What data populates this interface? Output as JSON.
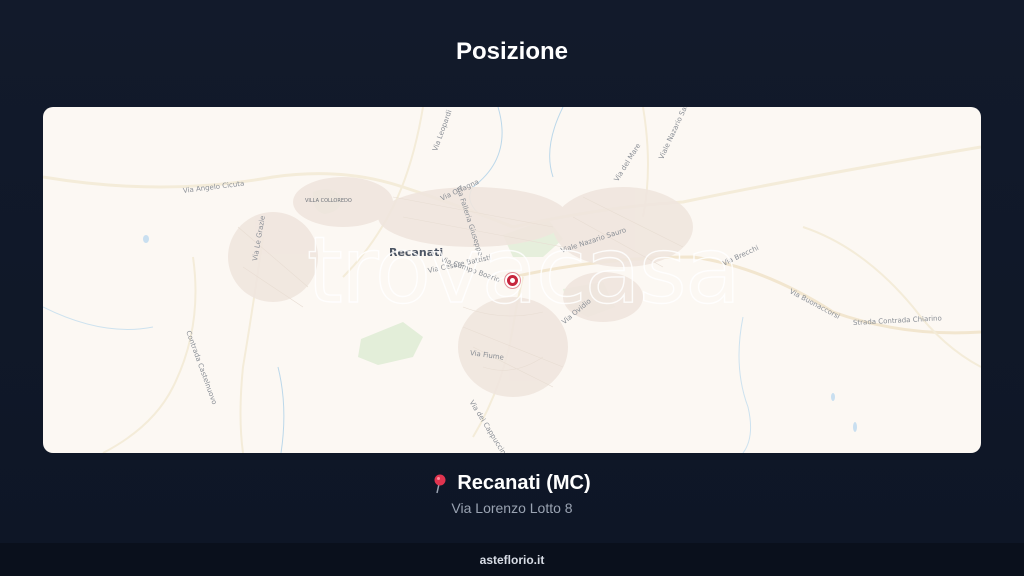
{
  "page": {
    "title": "Posizione"
  },
  "map": {
    "watermark": "trovacasa",
    "town_label": "Recanati",
    "villa_label": "VILLA COLLOREDO",
    "street_labels": [
      "Via Angelo Cicuta",
      "Via Le Grazie",
      "Contrada Castelnuovo",
      "Via Leopardi",
      "Via Falleria Giuseppe",
      "Via Orfagna",
      "Via Campo Boario",
      "Via Cesare Battisti",
      "Viale Nazario Sauro",
      "Via del Mare",
      "Via Brecchi",
      "Via Buonaccorsi",
      "Strada Contrada Chiarino",
      "Viale Nazario Sauro",
      "Via Ovidio",
      "Via Fiume",
      "Via dei Cappuccini"
    ],
    "marker_icon": "map-marker-icon",
    "accent_color": "#c6253e"
  },
  "location": {
    "pin_icon": "round-pushpin-icon",
    "city": "Recanati (MC)",
    "address": "Via Lorenzo Lotto 8"
  },
  "footer": {
    "brand": "asteflorio.it"
  }
}
